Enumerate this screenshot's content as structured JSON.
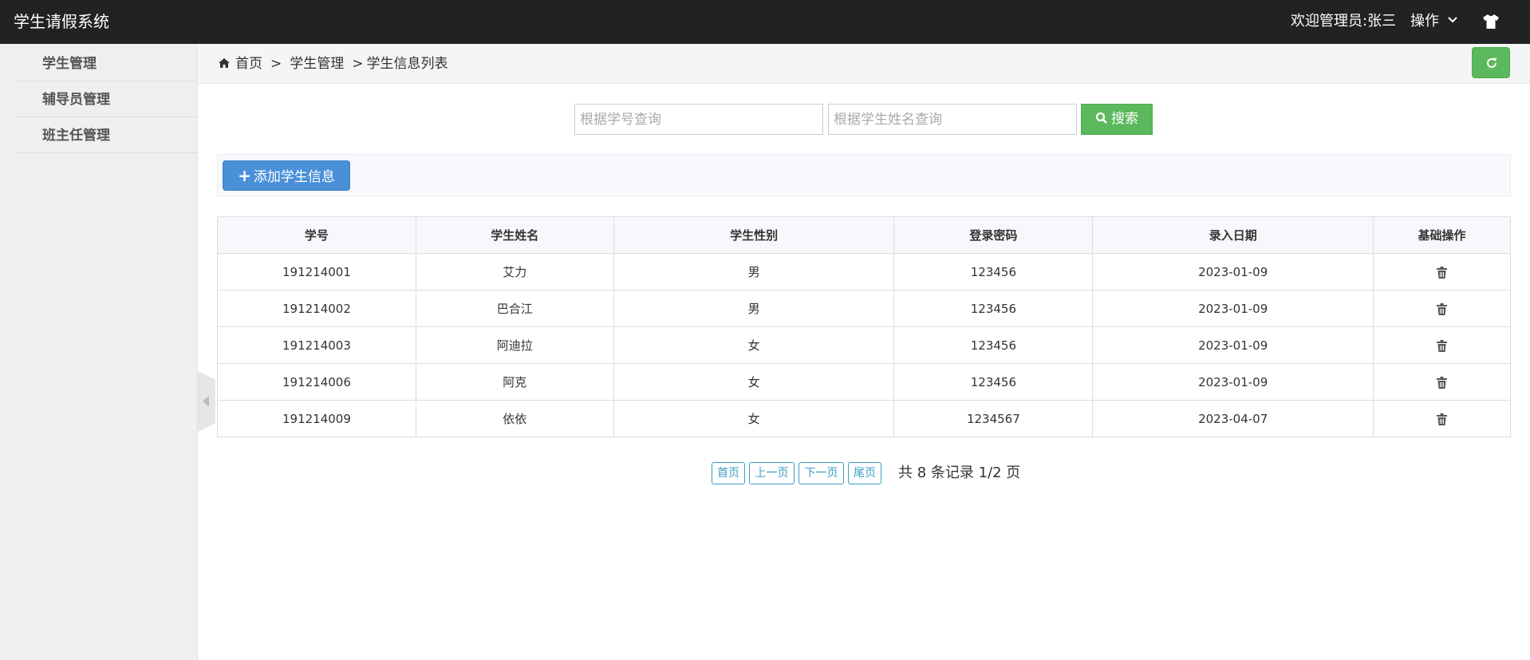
{
  "app": {
    "title": "学生请假系统"
  },
  "header": {
    "welcome": "欢迎管理员:张三",
    "ops_label": "操作"
  },
  "sidebar": {
    "items": [
      {
        "label": "学生管理"
      },
      {
        "label": "辅导员管理"
      },
      {
        "label": "班主任管理"
      }
    ]
  },
  "breadcrumb": {
    "home": "首页",
    "level1": "学生管理",
    "level2": "学生信息列表",
    "sep": ">"
  },
  "search": {
    "id_placeholder": "根据学号查询",
    "name_placeholder": "根据学生姓名查询",
    "button_label": "搜索"
  },
  "toolbar": {
    "add_label": "添加学生信息"
  },
  "table": {
    "headers": [
      "学号",
      "学生姓名",
      "学生性别",
      "登录密码",
      "录入日期",
      "基础操作"
    ],
    "rows": [
      {
        "id": "191214001",
        "name": "艾力",
        "gender": "男",
        "password": "123456",
        "date": "2023-01-09"
      },
      {
        "id": "191214002",
        "name": "巴合江",
        "gender": "男",
        "password": "123456",
        "date": "2023-01-09"
      },
      {
        "id": "191214003",
        "name": "阿迪拉",
        "gender": "女",
        "password": "123456",
        "date": "2023-01-09"
      },
      {
        "id": "191214006",
        "name": "阿克",
        "gender": "女",
        "password": "123456",
        "date": "2023-01-09"
      },
      {
        "id": "191214009",
        "name": "依依",
        "gender": "女",
        "password": "1234567",
        "date": "2023-04-07"
      }
    ]
  },
  "pagination": {
    "first": "首页",
    "prev": "上一页",
    "next": "下一页",
    "last": "尾页",
    "summary": "共 8 条记录 1/2 页"
  },
  "colors": {
    "topbar": "#222222",
    "success": "#5cb85c",
    "primary": "#4a90d9",
    "pager": "#3a9fc6"
  },
  "icons": [
    "chevron-down-icon",
    "shirt-icon",
    "caret-left-icon",
    "home-icon",
    "refresh-icon",
    "search-icon",
    "plus-icon",
    "trash-icon"
  ]
}
